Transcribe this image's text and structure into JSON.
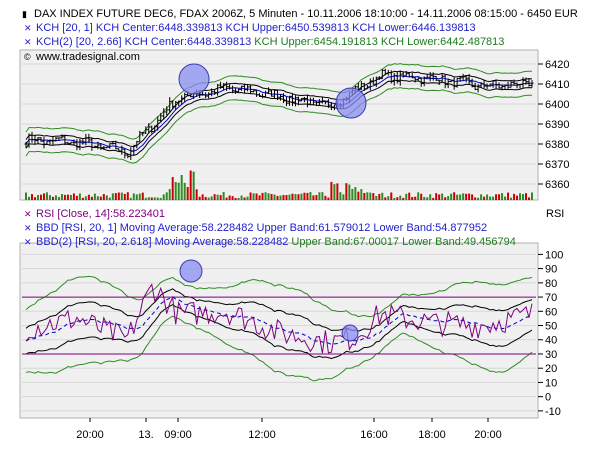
{
  "header": {
    "title": "DAX INDEX FUTURE DEC6, FDAX 2006Z, 5 Minuten - 10.11.2006 18:10:00 - 14.11.2006 08:15:00 - 6450 EUR",
    "kch1": "KCH [20, 1] KCH Center:6448.339813 KCH Upper:6450.539813 KCH Lower:6446.139813",
    "kch2_a": "KCH(2) [20, 2.66] KCH Center:6448.339813 ",
    "kch2_b": "KCH Upper:6454.191813 KCH Lower:6442.487813",
    "watermark": "www.tradesignal.com"
  },
  "rsi_header": {
    "rsi": "RSI [Close, 14]:58.223401",
    "bbd": "BBD [RSI, 20, 1] Moving Average:58.228482 Upper Band:61.579012 Lower Band:54.877952",
    "bbd2_a": "BBD(2) [RSI, 20, 2.618] Moving Average:58.228482 ",
    "bbd2_b": "Upper Band:67.00017 Lower Band:49.456794",
    "axis_title": "RSI"
  },
  "colors": {
    "price_bars": "#000000",
    "kch_center": "#0000cc",
    "kch_inner": "#000000",
    "kch_outer": "#2e8b22",
    "volume_up": "#2e8b22",
    "volume_down": "#cc0000",
    "rsi": "#800080",
    "bbd_ma": "#0000cc",
    "bbd_band": "#000000",
    "bbd2_band": "#2e8b22",
    "threshold": "#800080",
    "circle_fill": "#8a8ef0"
  },
  "chart_data": [
    {
      "type": "line",
      "panel": "price",
      "ylim": [
        6352,
        6427
      ],
      "yticks": [
        6360,
        6370,
        6380,
        6390,
        6400,
        6410,
        6420
      ],
      "series": [
        {
          "name": "KCH Center",
          "x": [
            0,
            10,
            20,
            30,
            40,
            50,
            60,
            70,
            80,
            90,
            100
          ],
          "y": [
            6382,
            6381,
            6376,
            6403,
            6408,
            6404,
            6399,
            6414,
            6413,
            6409,
            6410
          ]
        },
        {
          "name": "KCH Upper",
          "x": [
            0,
            10,
            20,
            30,
            40,
            50,
            60,
            70,
            80,
            90,
            100
          ],
          "y": [
            6384,
            6383,
            6379,
            6409,
            6411,
            6406,
            6401,
            6417,
            6415,
            6411,
            6412
          ]
        },
        {
          "name": "KCH Lower",
          "x": [
            0,
            10,
            20,
            30,
            40,
            50,
            60,
            70,
            80,
            90,
            100
          ],
          "y": [
            6380,
            6379,
            6373,
            6397,
            6405,
            6402,
            6397,
            6411,
            6411,
            6407,
            6408
          ]
        }
      ]
    },
    {
      "type": "line",
      "panel": "rsi",
      "ylim": [
        -15,
        108
      ],
      "yticks": [
        -10,
        0,
        10,
        20,
        30,
        40,
        50,
        60,
        70,
        80,
        90,
        100
      ],
      "thresholds": [
        30,
        70
      ],
      "series": [
        {
          "name": "RSI",
          "x": [
            0,
            10,
            20,
            25,
            30,
            40,
            50,
            60,
            65,
            70,
            80,
            90,
            100
          ],
          "y": [
            48,
            55,
            40,
            78,
            58,
            60,
            45,
            38,
            42,
            58,
            52,
            50,
            58
          ]
        }
      ]
    }
  ],
  "x_axis_labels": [
    "20:00",
    "13.",
    "09:00",
    "12:00",
    "16:00",
    "18:00",
    "20:00"
  ]
}
